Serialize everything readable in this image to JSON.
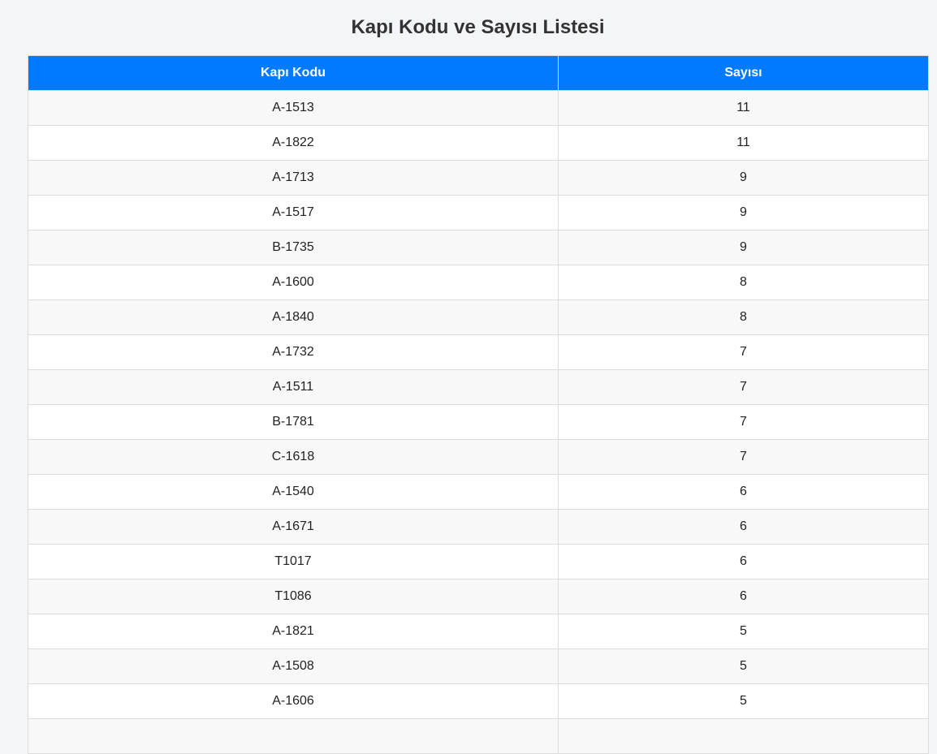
{
  "page": {
    "title": "Kapı Kodu ve Sayısı Listesi"
  },
  "table": {
    "headers": [
      "Kapı Kodu",
      "Sayısı"
    ],
    "rows": [
      [
        "A-1513",
        "11"
      ],
      [
        "A-1822",
        "11"
      ],
      [
        "A-1713",
        "9"
      ],
      [
        "A-1517",
        "9"
      ],
      [
        "B-1735",
        "9"
      ],
      [
        "A-1600",
        "8"
      ],
      [
        "A-1840",
        "8"
      ],
      [
        "A-1732",
        "7"
      ],
      [
        "A-1511",
        "7"
      ],
      [
        "B-1781",
        "7"
      ],
      [
        "C-1618",
        "7"
      ],
      [
        "A-1540",
        "6"
      ],
      [
        "A-1671",
        "6"
      ],
      [
        "T1017",
        "6"
      ],
      [
        "T1086",
        "6"
      ],
      [
        "A-1821",
        "5"
      ],
      [
        "A-1508",
        "5"
      ],
      [
        "A-1606",
        "5"
      ],
      [
        "",
        ""
      ]
    ]
  },
  "colors": {
    "header_bg": "#007bff",
    "header_text": "#ffffff",
    "row_alt_bg": "#f8f8f8",
    "page_bg": "#f4f5f8"
  }
}
